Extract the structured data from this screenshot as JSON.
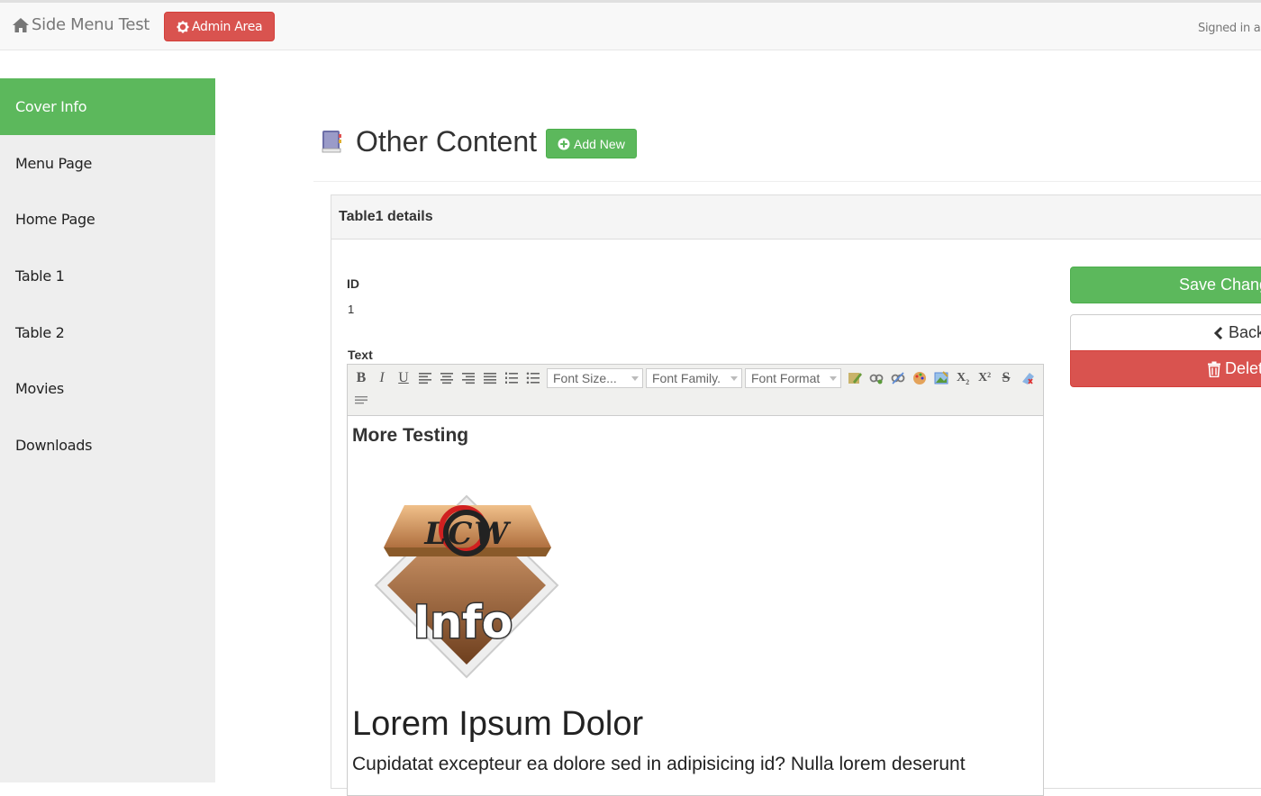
{
  "navbar": {
    "brand": "Side Menu Test",
    "brand_icon": "home-icon",
    "admin_label": "Admin Area",
    "admin_icon": "gear-icon",
    "signed_in": "Signed in as"
  },
  "sidebar": {
    "items": [
      {
        "label": "Cover Info",
        "active": true
      },
      {
        "label": "Menu Page"
      },
      {
        "label": "Home Page"
      },
      {
        "label": "Table 1"
      },
      {
        "label": "Table 2"
      },
      {
        "label": "Movies"
      },
      {
        "label": "Downloads"
      }
    ]
  },
  "main": {
    "title": "Other Content",
    "title_icon": "book-icon",
    "add_label": "Add New",
    "panel_title": "Table1 details",
    "id_label": "ID",
    "id_value": "1",
    "text_label": "Text"
  },
  "editor": {
    "font_size": "Font Size...",
    "font_family": "Font Family.",
    "font_format": "Font Format",
    "content_heading": "More Testing",
    "logo_top": "LCW",
    "logo_bottom": "Info",
    "content_h1": "Lorem Ipsum Dolor",
    "content_para": "Cupidatat excepteur ea dolore sed in adipisicing id? Nulla lorem deserunt"
  },
  "actions": {
    "save_label": "Save Changes",
    "back_label": "Back",
    "delete_label": "Delete"
  },
  "colors": {
    "success": "#5cb85c",
    "danger": "#d9534f",
    "sidebar_bg": "#eeeeee"
  }
}
